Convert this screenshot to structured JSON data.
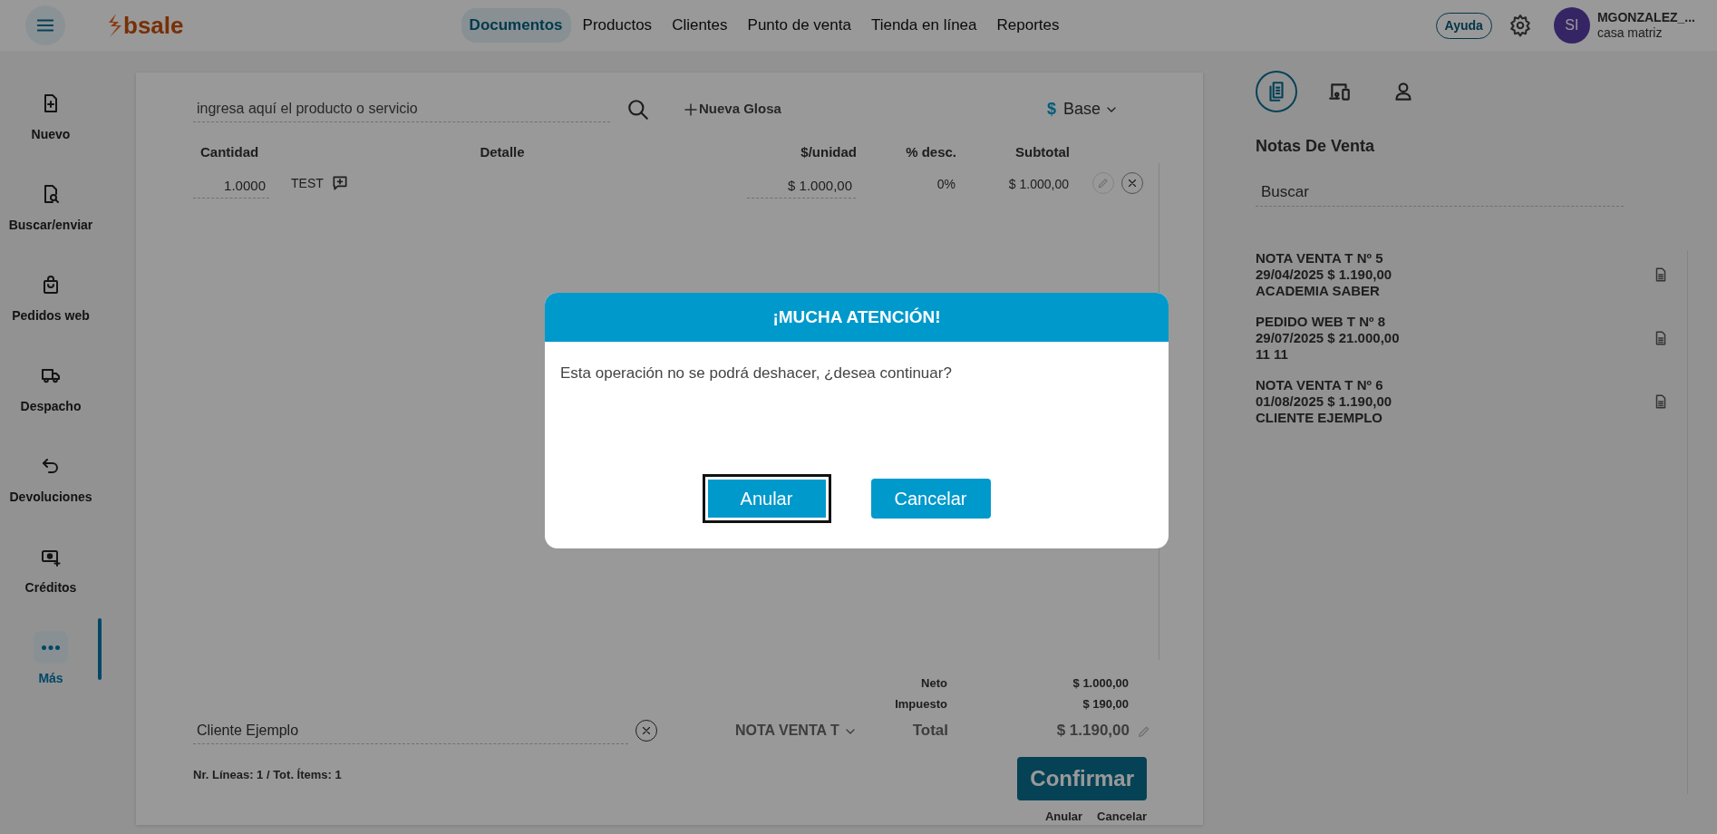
{
  "topbar": {
    "logo": "bsale",
    "nav": [
      {
        "label": "Documentos",
        "selected": true
      },
      {
        "label": "Productos",
        "selected": false
      },
      {
        "label": "Clientes",
        "selected": false
      },
      {
        "label": "Punto de venta",
        "selected": false
      },
      {
        "label": "Tienda en línea",
        "selected": false
      },
      {
        "label": "Reportes",
        "selected": false
      }
    ],
    "help_button": "Ayuda",
    "user": {
      "initials": "SI",
      "name": "MGONZALEZ_...",
      "branch": "casa matriz"
    }
  },
  "sidebar": {
    "items": [
      {
        "kind": "new",
        "label": "Nuevo",
        "selected": false
      },
      {
        "kind": "search",
        "label": "Buscar/enviar",
        "selected": false
      },
      {
        "kind": "bag",
        "label": "Pedidos web",
        "selected": false
      },
      {
        "kind": "truck",
        "label": "Despacho",
        "selected": false
      },
      {
        "kind": "return",
        "label": "Devoluciones",
        "selected": false
      },
      {
        "kind": "cash",
        "label": "Créditos",
        "selected": false
      },
      {
        "kind": "more",
        "label": "Más",
        "selected": true
      }
    ]
  },
  "document": {
    "search": {
      "placeholder": "ingresa aquí el producto o servicio"
    },
    "new_line_button": "Nueva Glosa",
    "price_list": {
      "symbol": "$",
      "label": "Base"
    },
    "columns": [
      "Cantidad",
      "Detalle",
      "$/unidad",
      "% desc.",
      "Subtotal"
    ],
    "rows": [
      {
        "quantity": "1.0000",
        "detail": "TEST",
        "unit_price": "$ 1.000,00",
        "discount": "0%",
        "subtotal": "$ 1.000,00"
      }
    ],
    "subtotals": [
      {
        "label": "Neto",
        "value": "$ 1.000,00"
      },
      {
        "label": "Impuesto",
        "value": "$ 190,00"
      }
    ],
    "client": {
      "value": "Cliente Ejemplo"
    },
    "document_type": "NOTA VENTA T",
    "total": {
      "label": "Total",
      "value": "$ 1.190,00"
    },
    "summary": "Nr. Líneas: 1 / Tot. Ítems: 1",
    "confirm_button": "Confirmar",
    "links": [
      "Anular",
      "Cancelar"
    ]
  },
  "side_panel": {
    "tabs": [
      {
        "kind": "documents",
        "selected": true
      },
      {
        "kind": "devices",
        "selected": false
      },
      {
        "kind": "person",
        "selected": false
      }
    ],
    "title": "Notas De Venta",
    "search": {
      "value": "Buscar"
    },
    "notes": [
      {
        "title": "NOTA VENTA T Nº 5",
        "detail": "29/04/2025 $ 1.190,00",
        "client": "ACADEMIA SABER"
      },
      {
        "title": "PEDIDO WEB T Nº 8",
        "detail": "29/07/2025 $ 21.000,00",
        "client": "11 11"
      },
      {
        "title": "NOTA VENTA T Nº 6",
        "detail": "01/08/2025 $ 1.190,00",
        "client": "CLIENTE EJEMPLO"
      }
    ]
  },
  "modal": {
    "title": "¡MUCHA ATENCIÓN!",
    "message": "Esta operación no se podrá deshacer, ¿desea continuar?",
    "buttons": [
      {
        "label": "Anular",
        "focused": true
      },
      {
        "label": "Cancelar",
        "focused": false
      }
    ]
  }
}
